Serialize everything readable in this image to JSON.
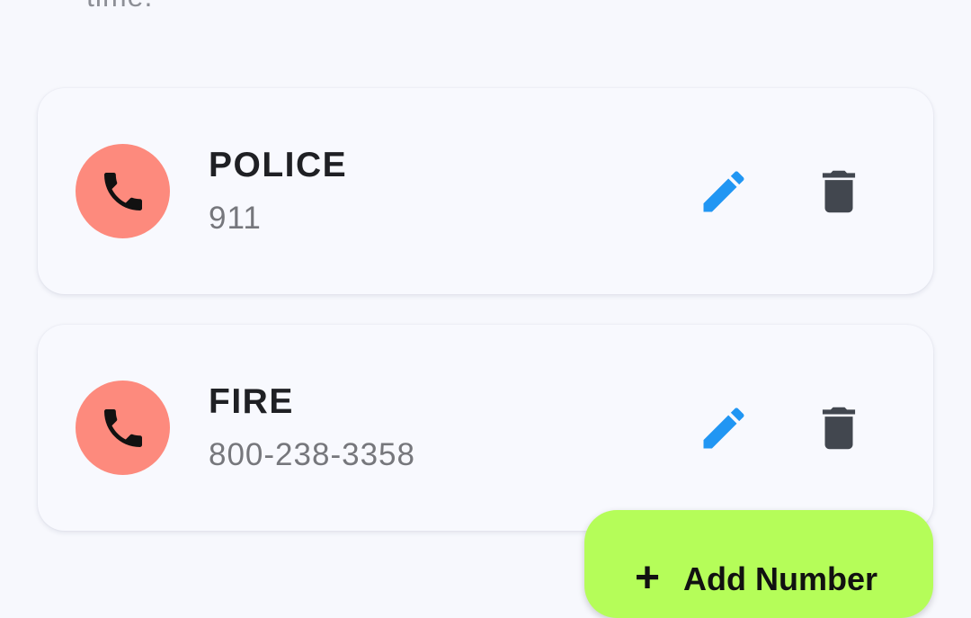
{
  "header": {
    "description_tail": "time."
  },
  "contacts": [
    {
      "name": "POLICE",
      "number": "911"
    },
    {
      "name": "FIRE",
      "number": "800-238-3358"
    }
  ],
  "icons": {
    "avatar": "phone-icon",
    "edit": "pencil-icon",
    "delete": "trash-icon"
  },
  "colors": {
    "background": "#f7f8fd",
    "card": "#f8f9fe",
    "avatar": "#fd8a7d",
    "edit_icon": "#2196f3",
    "delete_icon": "#42474f",
    "fab": "#b5fd59"
  },
  "fab": {
    "icon": "+",
    "label": "Add Number"
  }
}
